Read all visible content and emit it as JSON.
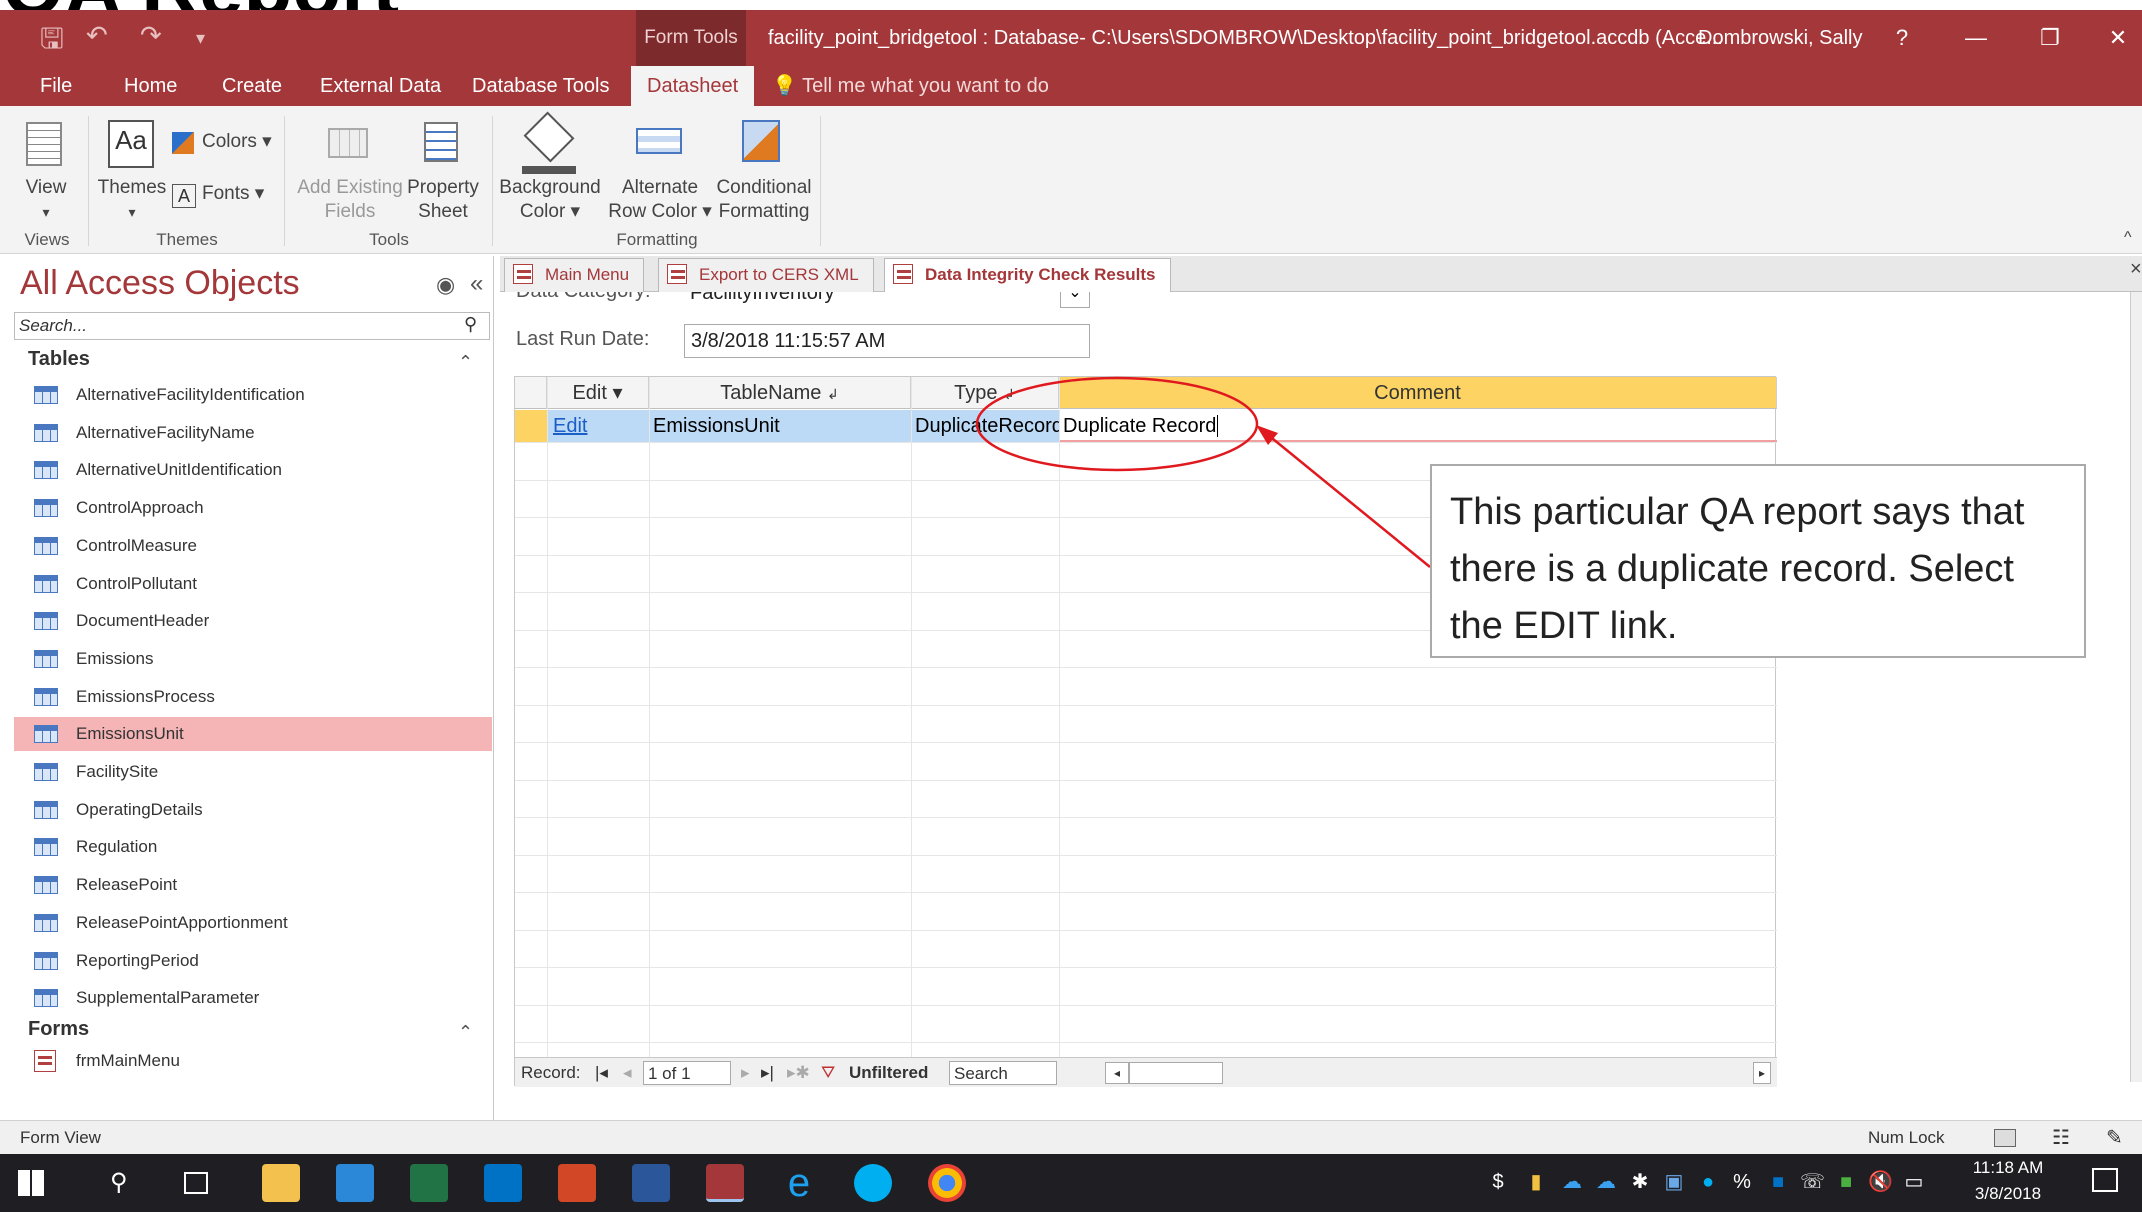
{
  "window": {
    "context_tab": "Form Tools",
    "title": "facility_point_bridgetool : Database- C:\\Users\\SDOMBROW\\Desktop\\facility_point_bridgetool.accdb (Acce...",
    "user": "Dombrowski, Sally",
    "help": "?",
    "minimize": "—",
    "restore": "❐",
    "close": "✕",
    "top_strip_text": "QA Report"
  },
  "menu": {
    "tabs": [
      "File",
      "Home",
      "Create",
      "External Data",
      "Database Tools",
      "Datasheet"
    ],
    "active": "Datasheet",
    "tell_me": "Tell me what you want to do"
  },
  "ribbon": {
    "view": "View",
    "themes": "Themes",
    "colors": "Colors",
    "fonts": "Fonts",
    "add_existing": "Add Existing",
    "fields": "Fields",
    "property": "Property",
    "sheet": "Sheet",
    "background": "Background",
    "color": "Color",
    "alternate": "Alternate",
    "row_color": "Row Color",
    "conditional": "Conditional",
    "formatting": "Formatting",
    "groups": [
      "Views",
      "Themes",
      "Tools",
      "Formatting"
    ]
  },
  "nav": {
    "title": "All Access Objects",
    "search_placeholder": "Search...",
    "tables_header": "Tables",
    "forms_header": "Forms",
    "tables": [
      "AlternativeFacilityIdentification",
      "AlternativeFacilityName",
      "AlternativeUnitIdentification",
      "ControlApproach",
      "ControlMeasure",
      "ControlPollutant",
      "DocumentHeader",
      "Emissions",
      "EmissionsProcess",
      "EmissionsUnit",
      "FacilitySite",
      "OperatingDetails",
      "Regulation",
      "ReleasePoint",
      "ReleasePointApportionment",
      "ReportingPeriod",
      "SupplementalParameter"
    ],
    "selected": "EmissionsUnit",
    "forms": [
      "frmMainMenu"
    ]
  },
  "doc_tabs": [
    "Main Menu",
    "Export to CERS XML",
    "Data Integrity Check Results"
  ],
  "form": {
    "data_category_label": "Data Category:",
    "data_category_value": "FacilityInventory",
    "last_run_label": "Last Run Date:",
    "last_run_value": "3/8/2018 11:15:57 AM"
  },
  "grid": {
    "headers": [
      "Edit",
      "TableName",
      "Type",
      "Comment"
    ],
    "row": {
      "edit": "Edit",
      "table": "EmissionsUnit",
      "type": "DuplicateRecord",
      "comment": "Duplicate Record"
    }
  },
  "record_nav": {
    "label": "Record:",
    "position": "1 of 1",
    "filter": "Unfiltered",
    "search": "Search"
  },
  "callout": {
    "text": "This particular QA report says that there is a duplicate record. Select the EDIT link."
  },
  "status": {
    "left": "Form View",
    "numlock": "Num Lock"
  },
  "taskbar": {
    "time": "11:18 AM",
    "date": "3/8/2018"
  },
  "colors": {
    "accent": "#a4373a",
    "selection": "#f5b4b6",
    "header_highlight": "#fdd463",
    "annotation_red": "#e0191f"
  }
}
